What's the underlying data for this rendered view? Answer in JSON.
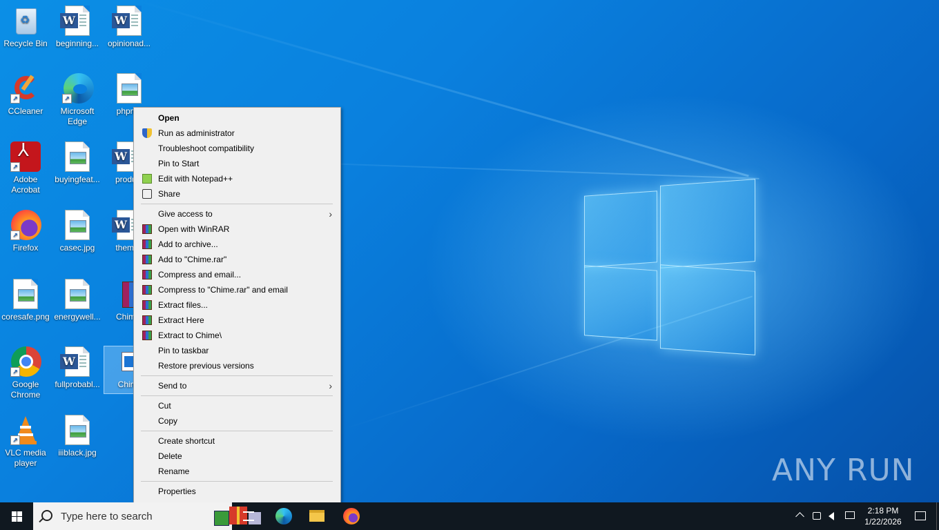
{
  "desktop": {
    "icons": [
      {
        "label": "Recycle Bin"
      },
      {
        "label": "beginning..."
      },
      {
        "label": "opinionad..."
      },
      {
        "label": "CCleaner"
      },
      {
        "label": "Microsoft Edge"
      },
      {
        "label": "phpma"
      },
      {
        "label": "Adobe Acrobat"
      },
      {
        "label": "buyingfeat..."
      },
      {
        "label": "product"
      },
      {
        "label": "Firefox"
      },
      {
        "label": "casec.jpg"
      },
      {
        "label": "themse"
      },
      {
        "label": "coresafe.png"
      },
      {
        "label": "energywell..."
      },
      {
        "label": "Chime."
      },
      {
        "label": "Google Chrome"
      },
      {
        "label": "fullprobabl..."
      },
      {
        "label": "Chime"
      },
      {
        "label": "VLC media player"
      },
      {
        "label": "iiiblack.jpg"
      }
    ],
    "watermark": "ANY RUN"
  },
  "context_menu": {
    "items": [
      {
        "label": "Open",
        "icon": "none"
      },
      {
        "label": "Run as administrator",
        "icon": "uac-shield-icon"
      },
      {
        "label": "Troubleshoot compatibility",
        "icon": "none"
      },
      {
        "label": "Pin to Start",
        "icon": "none"
      },
      {
        "label": "Edit with Notepad++",
        "icon": "notepadpp-icon"
      },
      {
        "label": "Share",
        "icon": "share-icon"
      },
      {
        "label": "Give access to",
        "icon": "none"
      },
      {
        "label": "Open with WinRAR",
        "icon": "winrar-icon"
      },
      {
        "label": "Add to archive...",
        "icon": "winrar-icon"
      },
      {
        "label": "Add to \"Chime.rar\"",
        "icon": "winrar-icon"
      },
      {
        "label": "Compress and email...",
        "icon": "winrar-icon"
      },
      {
        "label": "Compress to \"Chime.rar\" and email",
        "icon": "winrar-icon"
      },
      {
        "label": "Extract files...",
        "icon": "winrar-icon"
      },
      {
        "label": "Extract Here",
        "icon": "winrar-icon"
      },
      {
        "label": "Extract to Chime\\",
        "icon": "winrar-icon"
      },
      {
        "label": "Pin to taskbar",
        "icon": "none"
      },
      {
        "label": "Restore previous versions",
        "icon": "none"
      },
      {
        "label": "Send to",
        "icon": "none"
      },
      {
        "label": "Cut",
        "icon": "none"
      },
      {
        "label": "Copy",
        "icon": "none"
      },
      {
        "label": "Create shortcut",
        "icon": "none"
      },
      {
        "label": "Delete",
        "icon": "none"
      },
      {
        "label": "Rename",
        "icon": "none"
      },
      {
        "label": "Properties",
        "icon": "none"
      }
    ],
    "submenu_glyph": "›"
  },
  "taskbar": {
    "search_placeholder": "Type here to search",
    "time": "2:18 PM",
    "date": "1/22/2026"
  },
  "colors": {
    "accent": "#0a78d4",
    "taskbar": "#101820",
    "menu_bg": "#f0f0f0"
  }
}
